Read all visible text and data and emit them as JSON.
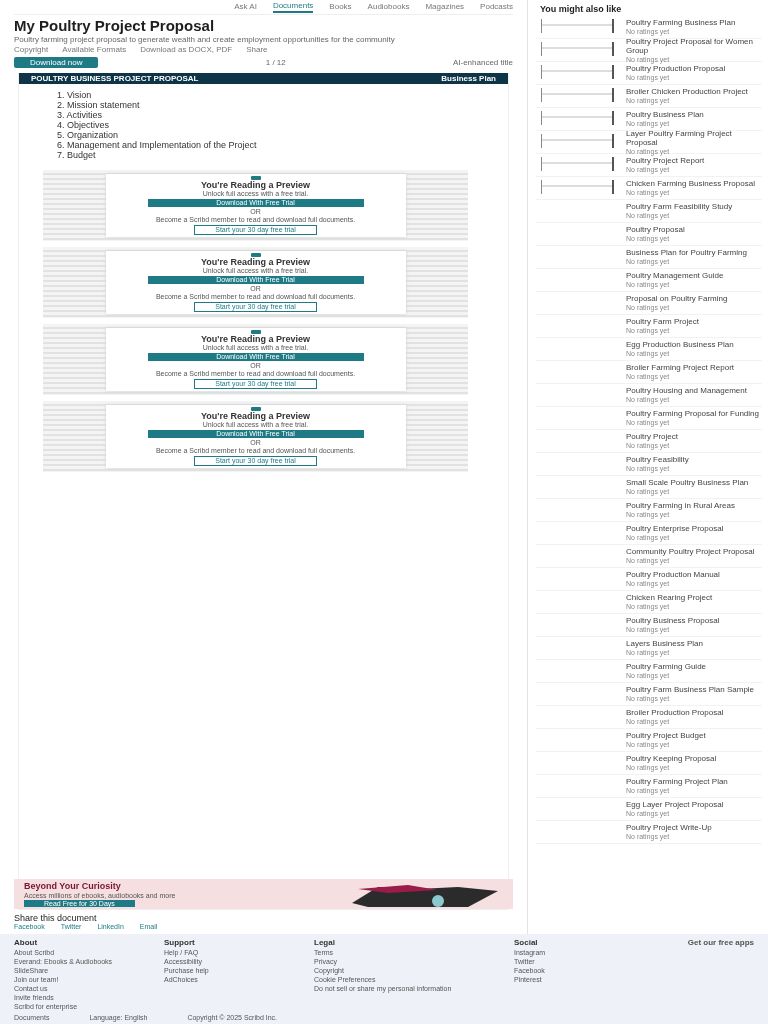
{
  "nav": {
    "links": [
      {
        "label": "Ask AI",
        "selected": false
      },
      {
        "label": "Documents",
        "selected": true
      },
      {
        "label": "Books",
        "selected": false
      },
      {
        "label": "Audiobooks",
        "selected": false
      },
      {
        "label": "Magazines",
        "selected": false
      },
      {
        "label": "Podcasts",
        "selected": false
      }
    ]
  },
  "document": {
    "title": "My Poultry Project Proposal",
    "description": "Poultry farming project proposal to generate wealth and create employment opportunities for the community",
    "meta": [
      "Copyright",
      "Available Formats",
      "Download as DOCX, PDF",
      "Share"
    ],
    "download_button": "Download now",
    "page_counter": "1 / 12",
    "toolbar_title": "AI-enhanced title",
    "page_header": "POULTRY BUSINESS PROJECT PROPOSAL",
    "page_subheader": "Business Plan",
    "contents": [
      "1. Vision",
      "2. Mission statement",
      "3. Activities",
      "4. Objectives",
      "5. Organization",
      "6. Management and Implementation of the Project",
      "7. Budget"
    ],
    "previews": [
      {
        "heading": "You're Reading a Preview",
        "subheading": "Unlock full access with a free trial.",
        "button": "Download With Free Trial",
        "or": "OR",
        "note": "Become a Scribd member to read and download full documents.",
        "link": "Start your 30 day free trial"
      },
      {
        "heading": "You're Reading a Preview",
        "subheading": "Unlock full access with a free trial.",
        "button": "Download With Free Trial",
        "or": "OR",
        "note": "Become a Scribd member to read and download full documents.",
        "link": "Start your 30 day free trial"
      },
      {
        "heading": "You're Reading a Preview",
        "subheading": "Unlock full access with a free trial.",
        "button": "Download With Free Trial",
        "or": "OR",
        "note": "Become a Scribd member to read and download full documents.",
        "link": "Start your 30 day free trial"
      },
      {
        "heading": "You're Reading a Preview",
        "subheading": "Unlock full access with a free trial.",
        "button": "Download With Free Trial",
        "or": "OR",
        "note": "Become a Scribd member to read and download full documents.",
        "link": "Start your 30 day free trial"
      }
    ],
    "banner": {
      "title": "Beyond Your Curiosity",
      "text": "Access millions of ebooks, audiobooks and more",
      "button": "Read Free for 30 Days"
    },
    "share": {
      "title": "Share this document",
      "options": [
        "Facebook",
        "Twitter",
        "LinkedIn",
        "Email"
      ]
    }
  },
  "sidebar": {
    "title": "You might also like",
    "items": [
      {
        "title": "Poultry Farming Business Plan",
        "meta": "No ratings yet",
        "thumb": true
      },
      {
        "title": "Poultry Project Proposal for Women Group",
        "meta": "No ratings yet",
        "thumb": true
      },
      {
        "title": "Poultry Production Proposal",
        "meta": "No ratings yet",
        "thumb": true
      },
      {
        "title": "Broiler Chicken Production Project",
        "meta": "No ratings yet",
        "thumb": true
      },
      {
        "title": "Poultry Business Plan",
        "meta": "No ratings yet",
        "thumb": true
      },
      {
        "title": "Layer Poultry Farming Project Proposal",
        "meta": "No ratings yet",
        "thumb": true
      },
      {
        "title": "Poultry Project Report",
        "meta": "No ratings yet",
        "thumb": true
      },
      {
        "title": "Chicken Farming Business Proposal",
        "meta": "No ratings yet",
        "thumb": true
      },
      {
        "title": "Poultry Farm Feasibility Study",
        "meta": "No ratings yet",
        "thumb": false
      },
      {
        "title": "Poultry Proposal",
        "meta": "No ratings yet",
        "thumb": false
      },
      {
        "title": "Business Plan for Poultry Farming",
        "meta": "No ratings yet",
        "thumb": false
      },
      {
        "title": "Poultry Management Guide",
        "meta": "No ratings yet",
        "thumb": false
      },
      {
        "title": "Proposal on Poultry Farming",
        "meta": "No ratings yet",
        "thumb": false
      },
      {
        "title": "Poultry Farm Project",
        "meta": "No ratings yet",
        "thumb": false
      },
      {
        "title": "Egg Production Business Plan",
        "meta": "No ratings yet",
        "thumb": false
      },
      {
        "title": "Broiler Farming Project Report",
        "meta": "No ratings yet",
        "thumb": false
      },
      {
        "title": "Poultry Housing and Management",
        "meta": "No ratings yet",
        "thumb": false
      },
      {
        "title": "Poultry Farming Proposal for Funding",
        "meta": "No ratings yet",
        "thumb": false
      },
      {
        "title": "Poultry Project",
        "meta": "No ratings yet",
        "thumb": false
      },
      {
        "title": "Poultry Feasibility",
        "meta": "No ratings yet",
        "thumb": false
      },
      {
        "title": "Small Scale Poultry Business Plan",
        "meta": "No ratings yet",
        "thumb": false
      },
      {
        "title": "Poultry Farming in Rural Areas",
        "meta": "No ratings yet",
        "thumb": false
      },
      {
        "title": "Poultry Enterprise Proposal",
        "meta": "No ratings yet",
        "thumb": false
      },
      {
        "title": "Community Poultry Project Proposal",
        "meta": "No ratings yet",
        "thumb": false
      },
      {
        "title": "Poultry Production Manual",
        "meta": "No ratings yet",
        "thumb": false
      },
      {
        "title": "Chicken Rearing Project",
        "meta": "No ratings yet",
        "thumb": false
      },
      {
        "title": "Poultry Business Proposal",
        "meta": "No ratings yet",
        "thumb": false
      },
      {
        "title": "Layers Business Plan",
        "meta": "No ratings yet",
        "thumb": false
      },
      {
        "title": "Poultry Farming Guide",
        "meta": "No ratings yet",
        "thumb": false
      },
      {
        "title": "Poultry Farm Business Plan Sample",
        "meta": "No ratings yet",
        "thumb": false
      },
      {
        "title": "Broiler Production Proposal",
        "meta": "No ratings yet",
        "thumb": false
      },
      {
        "title": "Poultry Project Budget",
        "meta": "No ratings yet",
        "thumb": false
      },
      {
        "title": "Poultry Keeping Proposal",
        "meta": "No ratings yet",
        "thumb": false
      },
      {
        "title": "Poultry Farming Project Plan",
        "meta": "No ratings yet",
        "thumb": false
      },
      {
        "title": "Egg Layer Project Proposal",
        "meta": "No ratings yet",
        "thumb": false
      },
      {
        "title": "Poultry Project Write-Up",
        "meta": "No ratings yet",
        "thumb": false
      }
    ]
  },
  "footer": {
    "columns": [
      {
        "heading": "About",
        "links": [
          "About Scribd",
          "Everand: Ebooks & Audiobooks",
          "SlideShare",
          "Join our team!",
          "Contact us",
          "Invite friends",
          "Scribd for enterprise"
        ]
      },
      {
        "heading": "Support",
        "links": [
          "Help / FAQ",
          "Accessibility",
          "Purchase help",
          "AdChoices"
        ]
      },
      {
        "heading": "Legal",
        "links": [
          "Terms",
          "Privacy",
          "Copyright",
          "Cookie Preferences",
          "Do not sell or share my personal information"
        ]
      },
      {
        "heading": "Social",
        "links": [
          "Instagram",
          "Twitter",
          "Facebook",
          "Pinterest"
        ]
      }
    ],
    "apps": "Get our free apps",
    "bottom_links": [
      "Documents",
      "Language: English",
      "Copyright © 2025 Scribd Inc."
    ]
  }
}
